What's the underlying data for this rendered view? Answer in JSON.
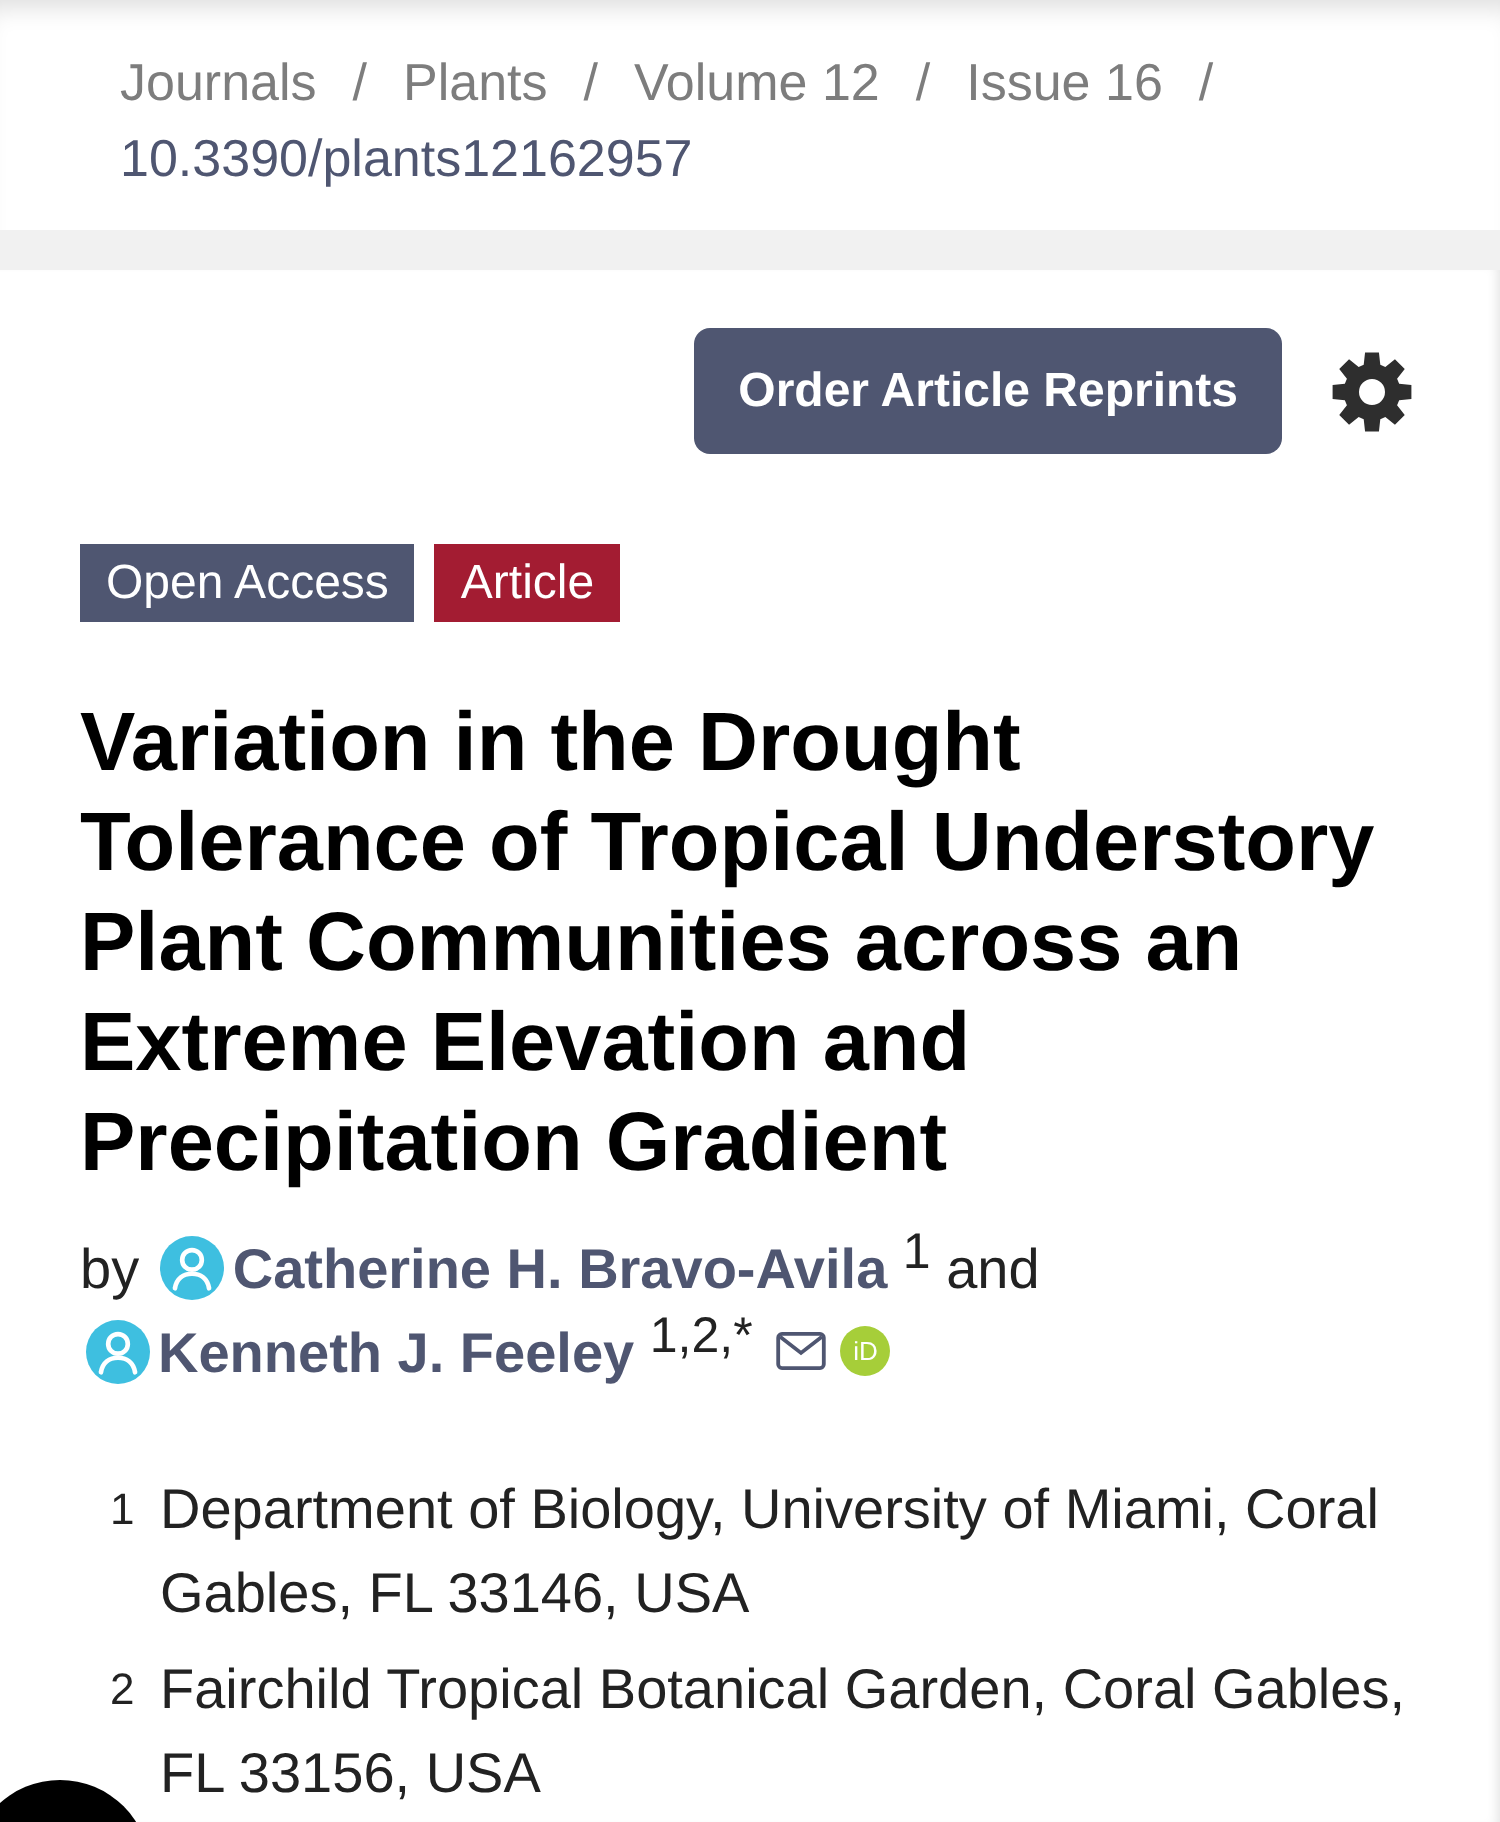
{
  "breadcrumb": [
    {
      "label": "Journals",
      "separator": "/",
      "current": false
    },
    {
      "label": "Plants",
      "separator": "/",
      "current": false
    },
    {
      "label": "Volume 12",
      "separator": "/",
      "current": false
    },
    {
      "label": "Issue 16",
      "separator": "/",
      "current": false
    },
    {
      "label": "10.3390/plants12162957",
      "current": true
    }
  ],
  "actions": {
    "button": "Order Article Reprints"
  },
  "tags": [
    {
      "label": "Open Access",
      "color": "#4f5671"
    },
    {
      "label": "Article",
      "color": "#a31c32"
    }
  ],
  "title": "Variation in the Drought Tolerance of Tropical Understory Plant Communities across an Extreme Elevation and Precipitation Gradient",
  "byline": {
    "prefix": "by",
    "authors": [
      {
        "name": "Catherine H. Bravo-Avila",
        "affiliations": "1",
        "separator": "and",
        "email": false
      },
      {
        "name": "Kenneth J. Feeley",
        "affiliations": "1,2,*",
        "email": true,
        "orcid_badge": "iD"
      }
    ]
  },
  "affiliations": [
    {
      "number": "1",
      "text": "Department of Biology, University of Miami, Coral Gables, FL 33146, USA"
    },
    {
      "number": "2",
      "text": "Fairchild Tropical Botanical Garden, Coral Gables, FL 33156, USA"
    }
  ]
}
